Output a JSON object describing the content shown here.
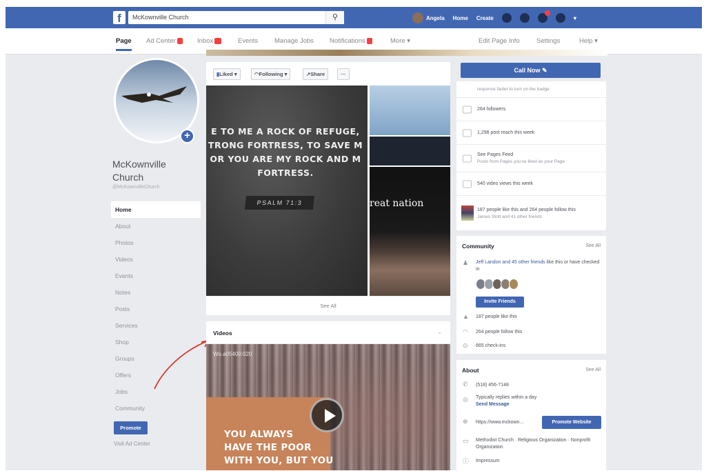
{
  "topbar": {
    "logo": "f",
    "search_value": "McKownville Church",
    "user_name": "Angela",
    "home": "Home",
    "create": "Create"
  },
  "subnav": {
    "page": "Page",
    "ad_center": "Ad Center",
    "inbox": "Inbox",
    "events": "Events",
    "manage_jobs": "Manage Jobs",
    "notifications": "Notifications",
    "more": "More ▾",
    "edit_page_info": "Edit Page Info",
    "settings": "Settings",
    "help": "Help ▾"
  },
  "profile": {
    "name": "McKownville Church",
    "handle": "@McKownvilleChurch"
  },
  "leftnav": {
    "items": [
      "Home",
      "About",
      "Photos",
      "Videos",
      "Events",
      "Notes",
      "Posts",
      "Services",
      "Shop",
      "Groups",
      "Offers",
      "Jobs",
      "Community"
    ],
    "promote": "Promote",
    "visit_ad_center": "Visit Ad Center"
  },
  "actionbar": {
    "liked": "Liked ▾",
    "following": "Following ▾",
    "share": "Share",
    "more": "···"
  },
  "photos": {
    "verse_lines": [
      "E TO ME A ROCK OF REFUGE,",
      "TRONG FORTRESS, TO SAVE M",
      "OR YOU ARE MY ROCK AND M",
      "FORTRESS."
    ],
    "psalm": "PSALM 71:3",
    "side_text": "reat nation",
    "see_all": "See All"
  },
  "videos": {
    "title": "Videos",
    "timestamp": "Wo.a05400:020",
    "overlay_lines": [
      "YOU ALWAYS",
      "HAVE THE POOR",
      "WITH YOU, BUT YOU"
    ]
  },
  "right": {
    "call_now": "Call Now ✎",
    "stats": {
      "badge_hint": "response faster to turn on the badge",
      "followers": "264 followers",
      "post_reach": "1,298 post reach this week",
      "pages_feed": "See Pages Feed",
      "pages_feed_sub": "Posts from Pages you've liked as your Page",
      "video_views": "540 video views this week",
      "likes_follows": "187 people like this and 264 people follow this",
      "likes_follows_sub": "James Stott and 41 other friends"
    },
    "community": {
      "title": "Community",
      "see_all": "See All",
      "friend_link": "Jeff Landon and 45 other friends",
      "friend_rest": " like this or have checked in",
      "invite": "Invite Friends",
      "likes": "187 people like this",
      "follows": "264 people follow this",
      "checkins": "665 check-ins"
    },
    "about": {
      "title": "About",
      "see_all": "See All",
      "phone": "(518) 456-7148",
      "reply": "Typically replies within a day",
      "send_message": "Send Message",
      "website": "https://www.mckown...",
      "promote_website": "Promote Website",
      "category": "Methodist Church · Religious Organization · Nonprofit Organization",
      "impressum": "Impressum"
    }
  }
}
